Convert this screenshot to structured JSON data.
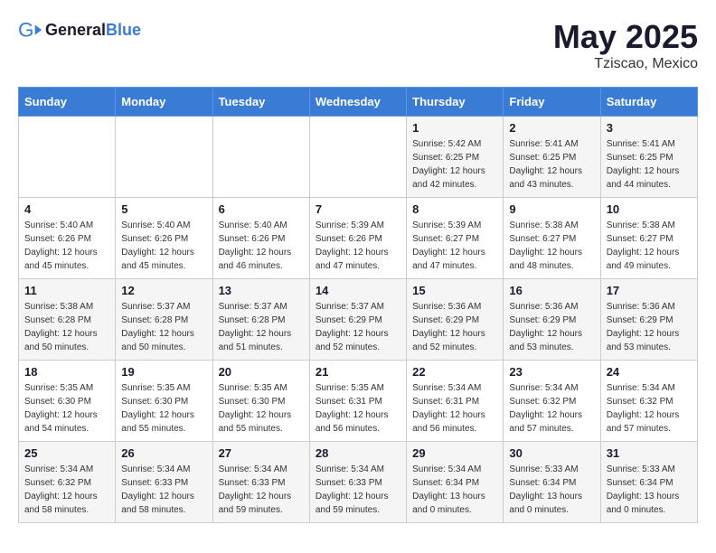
{
  "header": {
    "logo_general": "General",
    "logo_blue": "Blue",
    "month_year": "May 2025",
    "location": "Tziscao, Mexico"
  },
  "days_of_week": [
    "Sunday",
    "Monday",
    "Tuesday",
    "Wednesday",
    "Thursday",
    "Friday",
    "Saturday"
  ],
  "weeks": [
    [
      {
        "day": "",
        "info": ""
      },
      {
        "day": "",
        "info": ""
      },
      {
        "day": "",
        "info": ""
      },
      {
        "day": "",
        "info": ""
      },
      {
        "day": "1",
        "info": "Sunrise: 5:42 AM\nSunset: 6:25 PM\nDaylight: 12 hours\nand 42 minutes."
      },
      {
        "day": "2",
        "info": "Sunrise: 5:41 AM\nSunset: 6:25 PM\nDaylight: 12 hours\nand 43 minutes."
      },
      {
        "day": "3",
        "info": "Sunrise: 5:41 AM\nSunset: 6:25 PM\nDaylight: 12 hours\nand 44 minutes."
      }
    ],
    [
      {
        "day": "4",
        "info": "Sunrise: 5:40 AM\nSunset: 6:26 PM\nDaylight: 12 hours\nand 45 minutes."
      },
      {
        "day": "5",
        "info": "Sunrise: 5:40 AM\nSunset: 6:26 PM\nDaylight: 12 hours\nand 45 minutes."
      },
      {
        "day": "6",
        "info": "Sunrise: 5:40 AM\nSunset: 6:26 PM\nDaylight: 12 hours\nand 46 minutes."
      },
      {
        "day": "7",
        "info": "Sunrise: 5:39 AM\nSunset: 6:26 PM\nDaylight: 12 hours\nand 47 minutes."
      },
      {
        "day": "8",
        "info": "Sunrise: 5:39 AM\nSunset: 6:27 PM\nDaylight: 12 hours\nand 47 minutes."
      },
      {
        "day": "9",
        "info": "Sunrise: 5:38 AM\nSunset: 6:27 PM\nDaylight: 12 hours\nand 48 minutes."
      },
      {
        "day": "10",
        "info": "Sunrise: 5:38 AM\nSunset: 6:27 PM\nDaylight: 12 hours\nand 49 minutes."
      }
    ],
    [
      {
        "day": "11",
        "info": "Sunrise: 5:38 AM\nSunset: 6:28 PM\nDaylight: 12 hours\nand 50 minutes."
      },
      {
        "day": "12",
        "info": "Sunrise: 5:37 AM\nSunset: 6:28 PM\nDaylight: 12 hours\nand 50 minutes."
      },
      {
        "day": "13",
        "info": "Sunrise: 5:37 AM\nSunset: 6:28 PM\nDaylight: 12 hours\nand 51 minutes."
      },
      {
        "day": "14",
        "info": "Sunrise: 5:37 AM\nSunset: 6:29 PM\nDaylight: 12 hours\nand 52 minutes."
      },
      {
        "day": "15",
        "info": "Sunrise: 5:36 AM\nSunset: 6:29 PM\nDaylight: 12 hours\nand 52 minutes."
      },
      {
        "day": "16",
        "info": "Sunrise: 5:36 AM\nSunset: 6:29 PM\nDaylight: 12 hours\nand 53 minutes."
      },
      {
        "day": "17",
        "info": "Sunrise: 5:36 AM\nSunset: 6:29 PM\nDaylight: 12 hours\nand 53 minutes."
      }
    ],
    [
      {
        "day": "18",
        "info": "Sunrise: 5:35 AM\nSunset: 6:30 PM\nDaylight: 12 hours\nand 54 minutes."
      },
      {
        "day": "19",
        "info": "Sunrise: 5:35 AM\nSunset: 6:30 PM\nDaylight: 12 hours\nand 55 minutes."
      },
      {
        "day": "20",
        "info": "Sunrise: 5:35 AM\nSunset: 6:30 PM\nDaylight: 12 hours\nand 55 minutes."
      },
      {
        "day": "21",
        "info": "Sunrise: 5:35 AM\nSunset: 6:31 PM\nDaylight: 12 hours\nand 56 minutes."
      },
      {
        "day": "22",
        "info": "Sunrise: 5:34 AM\nSunset: 6:31 PM\nDaylight: 12 hours\nand 56 minutes."
      },
      {
        "day": "23",
        "info": "Sunrise: 5:34 AM\nSunset: 6:32 PM\nDaylight: 12 hours\nand 57 minutes."
      },
      {
        "day": "24",
        "info": "Sunrise: 5:34 AM\nSunset: 6:32 PM\nDaylight: 12 hours\nand 57 minutes."
      }
    ],
    [
      {
        "day": "25",
        "info": "Sunrise: 5:34 AM\nSunset: 6:32 PM\nDaylight: 12 hours\nand 58 minutes."
      },
      {
        "day": "26",
        "info": "Sunrise: 5:34 AM\nSunset: 6:33 PM\nDaylight: 12 hours\nand 58 minutes."
      },
      {
        "day": "27",
        "info": "Sunrise: 5:34 AM\nSunset: 6:33 PM\nDaylight: 12 hours\nand 59 minutes."
      },
      {
        "day": "28",
        "info": "Sunrise: 5:34 AM\nSunset: 6:33 PM\nDaylight: 12 hours\nand 59 minutes."
      },
      {
        "day": "29",
        "info": "Sunrise: 5:34 AM\nSunset: 6:34 PM\nDaylight: 13 hours\nand 0 minutes."
      },
      {
        "day": "30",
        "info": "Sunrise: 5:33 AM\nSunset: 6:34 PM\nDaylight: 13 hours\nand 0 minutes."
      },
      {
        "day": "31",
        "info": "Sunrise: 5:33 AM\nSunset: 6:34 PM\nDaylight: 13 hours\nand 0 minutes."
      }
    ]
  ]
}
